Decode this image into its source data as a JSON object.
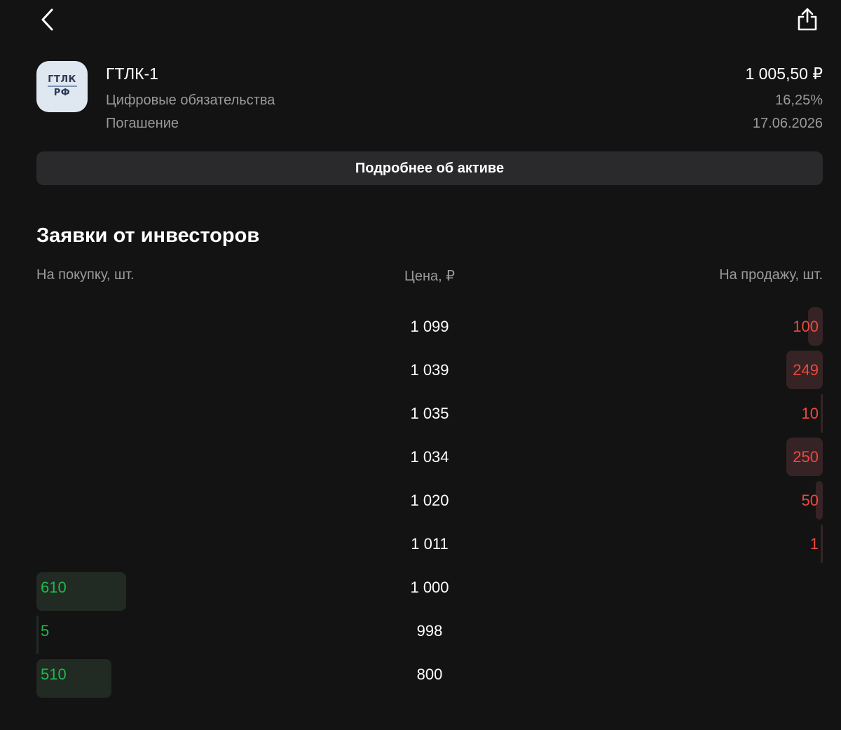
{
  "asset": {
    "logo_top": "ГТЛК",
    "logo_bottom": "РФ",
    "name": "ГТЛК-1",
    "type": "Цифровые обязательства",
    "price": "1 005,50 ₽",
    "yield": "16,25%",
    "maturity_label": "Погашение",
    "maturity_date": "17.06.2026"
  },
  "details_button": "Подробнее об активе",
  "orders": {
    "title": "Заявки от инвесторов",
    "col_buy": "На покупку, шт.",
    "col_price": "Цена, ₽",
    "col_sell": "На продажу, шт.",
    "max_qty": 610,
    "rows": [
      {
        "price": "1 099",
        "sell": "100",
        "sell_qty": 100
      },
      {
        "price": "1 039",
        "sell": "249",
        "sell_qty": 249
      },
      {
        "price": "1 035",
        "sell": "10",
        "sell_qty": 10
      },
      {
        "price": "1 034",
        "sell": "250",
        "sell_qty": 250
      },
      {
        "price": "1 020",
        "sell": "50",
        "sell_qty": 50
      },
      {
        "price": "1 011",
        "sell": "1",
        "sell_qty": 1
      },
      {
        "price": "1 000",
        "buy": "610",
        "buy_qty": 610
      },
      {
        "price": "998",
        "buy": "5",
        "buy_qty": 5
      },
      {
        "price": "800",
        "buy": "510",
        "buy_qty": 510
      }
    ]
  },
  "icons": {
    "back": "chevron-left-icon",
    "share": "share-icon"
  },
  "colors": {
    "background": "#131313",
    "buy": "#1fba4a",
    "sell": "#f2473e",
    "button": "#2a2a2c"
  }
}
